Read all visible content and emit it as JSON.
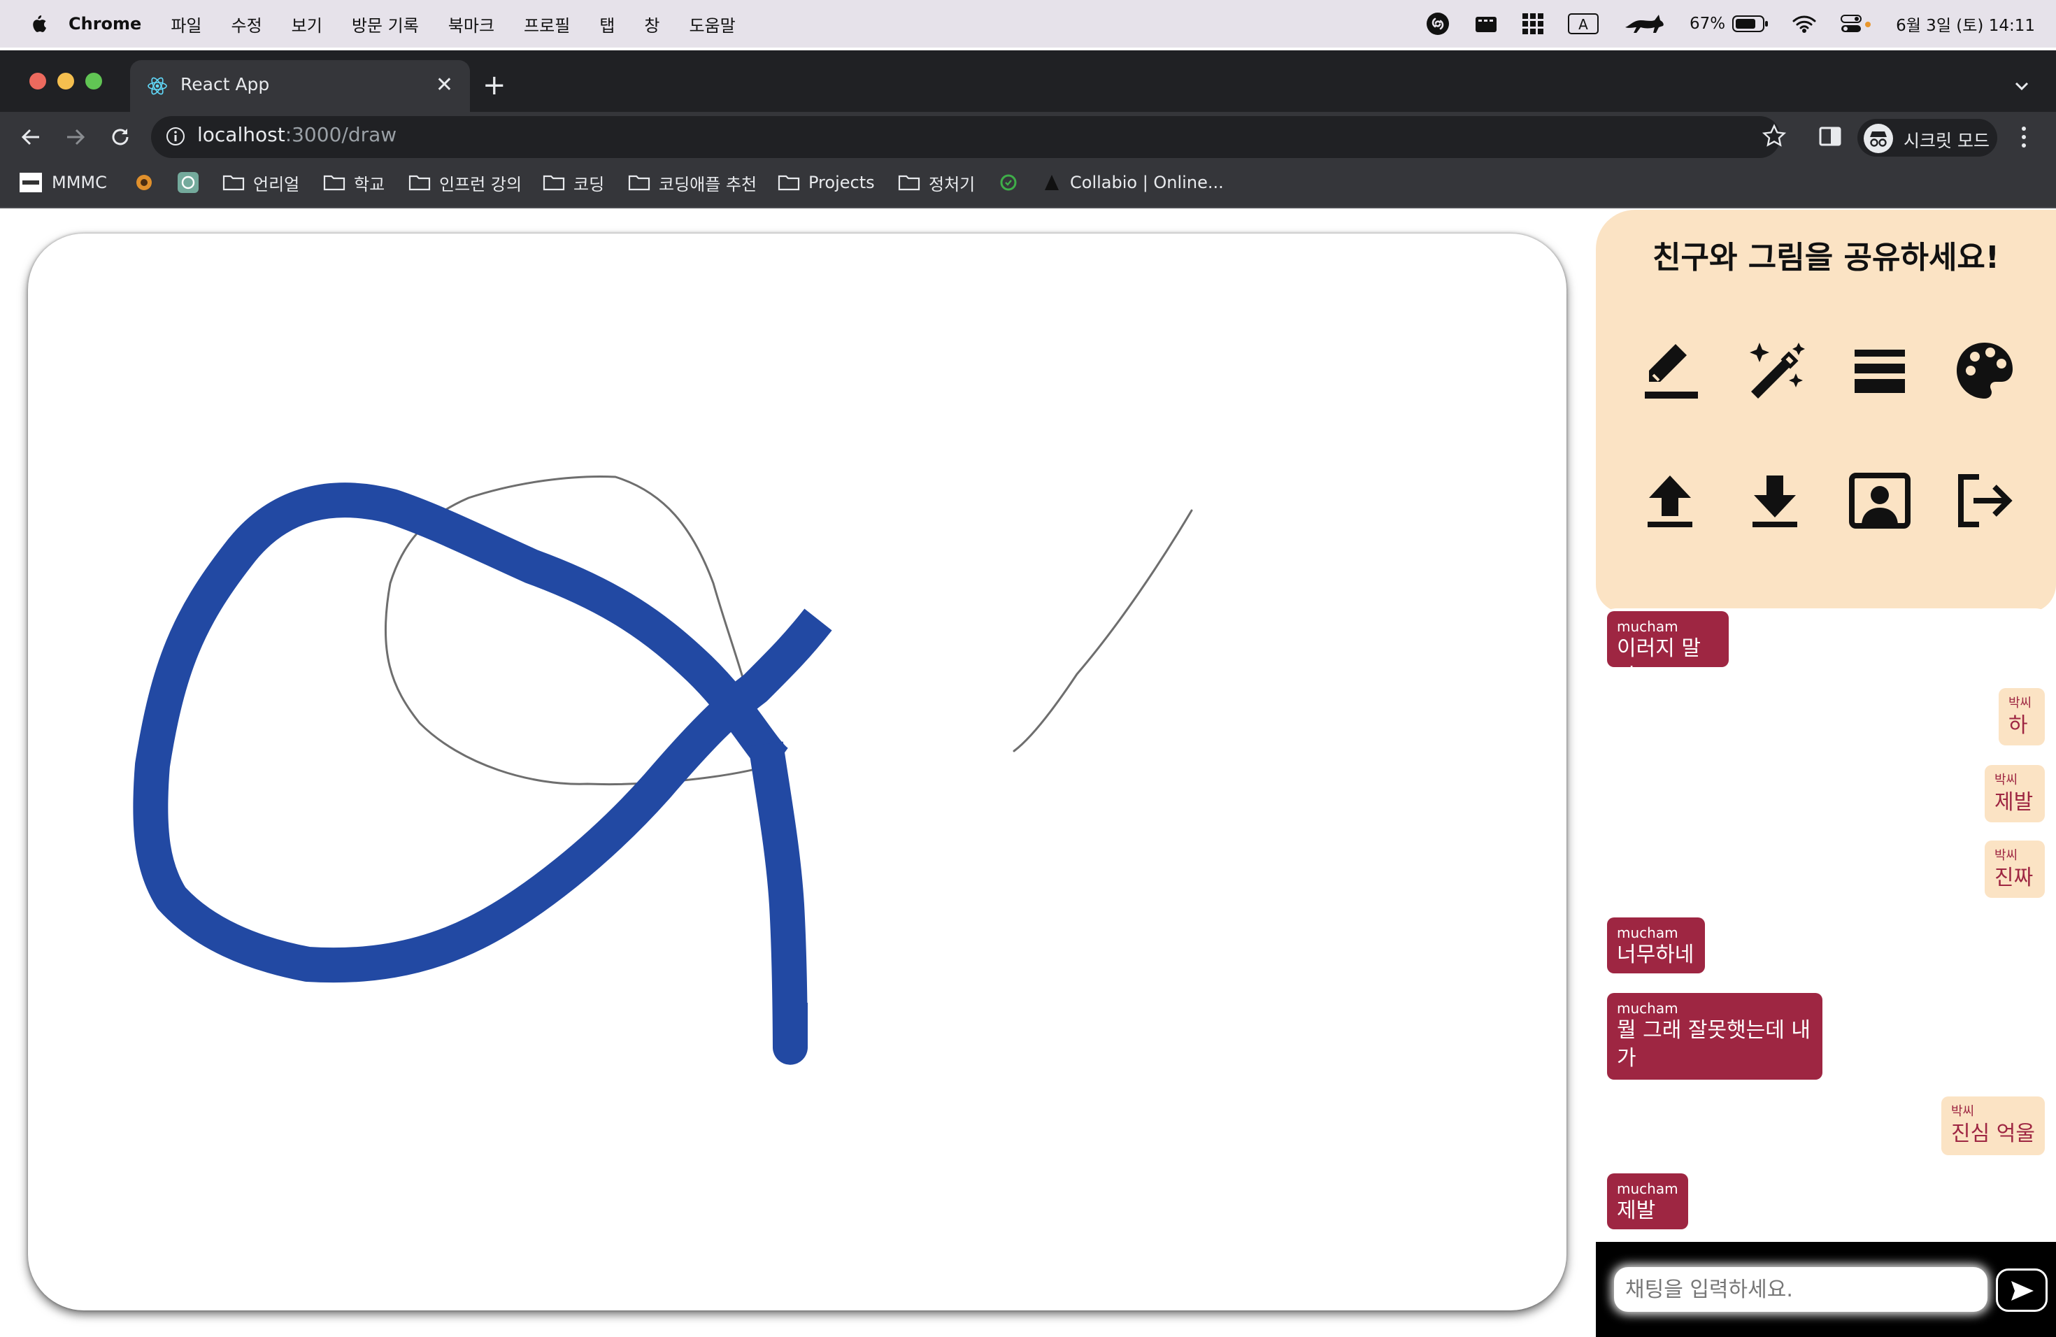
{
  "menubar": {
    "items": [
      "Chrome",
      "파일",
      "수정",
      "보기",
      "방문 기록",
      "북마크",
      "프로필",
      "탭",
      "창",
      "도움말"
    ],
    "battery": "67%",
    "datetime": "6월 3일 (토) 14:11"
  },
  "browser": {
    "tab_title": "React App",
    "url_host": "localhost",
    "url_rest": ":3000/draw",
    "incognito_label": "시크릿 모드"
  },
  "bookmarks": [
    "MMMC",
    "언리얼",
    "학교",
    "인프런 강의",
    "코딩",
    "코딩애플 추천",
    "Projects",
    "정처기",
    "Collabio | Online..."
  ],
  "panel": {
    "heading": "친구와 그림을 공유하세요!",
    "tools": [
      "pencil-icon",
      "magic-wand-icon",
      "line-width-icon",
      "palette-icon",
      "upload-icon",
      "download-icon",
      "user-card-icon",
      "logout-icon"
    ]
  },
  "chat": {
    "messages": [
      {
        "sender": "mucham",
        "text": "이러지 말자",
        "mine": true
      },
      {
        "sender": "박씨",
        "text": "하",
        "mine": false
      },
      {
        "sender": "박씨",
        "text": "제발",
        "mine": false
      },
      {
        "sender": "박씨",
        "text": "진짜",
        "mine": false
      },
      {
        "sender": "mucham",
        "text": "너무하네",
        "mine": true
      },
      {
        "sender": "mucham",
        "text": "뭘 그래 잘못햇는데 내가",
        "mine": true
      },
      {
        "sender": "박씨",
        "text": "진심 억울",
        "mine": false
      },
      {
        "sender": "mucham",
        "text": "제발",
        "mine": true
      }
    ],
    "input_placeholder": "채팅을 입력하세요."
  },
  "colors": {
    "stroke_thick": "#2249a3",
    "stroke_thin": "#6e6e6e",
    "panel_bg": "#fbe3c4",
    "my_bubble": "#9e2642"
  }
}
